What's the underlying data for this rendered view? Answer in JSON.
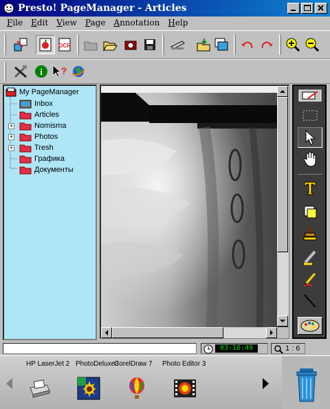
{
  "window": {
    "title": "Presto! PageManager - Articles"
  },
  "menu": [
    {
      "label": "File",
      "key": "F",
      "rest": "ile"
    },
    {
      "label": "Edit",
      "key": "E",
      "rest": "dit"
    },
    {
      "label": "View",
      "key": "V",
      "rest": "iew"
    },
    {
      "label": "Page",
      "key": "P",
      "rest": "age"
    },
    {
      "label": "Annotation",
      "key": "A",
      "rest": "nnotation"
    },
    {
      "label": "Help",
      "key": "H",
      "rest": "elp"
    }
  ],
  "toolbar": {
    "ocr_text": "OCR",
    "info_text": "i",
    "help_text": "?"
  },
  "tree": {
    "root": "My PageManager",
    "items": [
      {
        "label": "Inbox",
        "icon": "inbox-icon",
        "expandable": false
      },
      {
        "label": "Articles",
        "icon": "folder-icon",
        "expandable": false
      },
      {
        "label": "Nomisma",
        "icon": "folder-icon",
        "expandable": true
      },
      {
        "label": "Photos",
        "icon": "folder-icon",
        "expandable": true
      },
      {
        "label": "Tresh",
        "icon": "folder-icon",
        "expandable": true
      },
      {
        "label": "Графика",
        "icon": "folder-icon",
        "expandable": false
      },
      {
        "label": "Документы",
        "icon": "folder-icon",
        "expandable": false
      }
    ]
  },
  "status": {
    "message": "",
    "time": "03:10:49",
    "zoom": "1 : 6"
  },
  "launcher": {
    "apps": [
      {
        "label": "HP LaserJet 2",
        "icon": "printer-icon"
      },
      {
        "label": "PhotoDeluxe3",
        "icon": "photodeluxe-icon"
      },
      {
        "label": "CorelDraw 7",
        "icon": "balloon-icon"
      },
      {
        "label": "Photo Editor 3",
        "icon": "film-icon"
      }
    ],
    "trash_icon": "trash-icon"
  },
  "colors": {
    "title_start": "#000080",
    "title_end": "#1084d0",
    "tree_bg": "#aee6f7",
    "folder": "#e0304a",
    "clock_text": "#00e000"
  }
}
